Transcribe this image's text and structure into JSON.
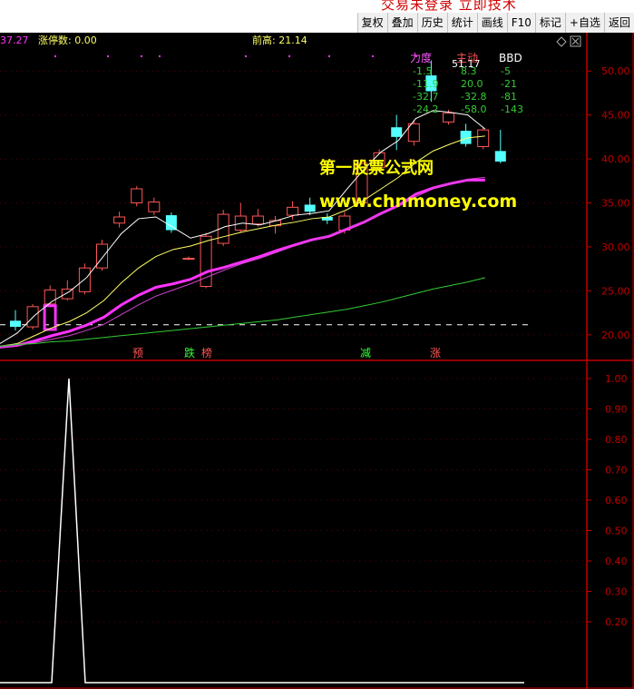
{
  "top_notice": "交易未登录   立即技术",
  "toolbar": [
    "复权",
    "叠加",
    "历史",
    "统计",
    "画线",
    "F10",
    "标记",
    "+自选",
    "返回"
  ],
  "info_bar": {
    "left_value": "37.27",
    "limit_up_count": "涨停数: 0.00",
    "prev_high": "前高: 21.14"
  },
  "right_icons": [
    "diamond-icon",
    "close-icon"
  ],
  "indicator_table": {
    "headers": [
      "力度",
      "主动",
      "BBD"
    ],
    "rows": [
      [
        "-1.5",
        "8.3",
        "-5"
      ],
      [
        "-11.9",
        "20.0",
        "-21"
      ],
      [
        "-32.7",
        "-32.8",
        "-81"
      ],
      [
        "-24.2",
        "-58.0",
        "-143"
      ]
    ],
    "overlay_price": "51.17"
  },
  "watermark": {
    "line1": "第一股票公式网",
    "line2": "www.chnmoney.com"
  },
  "signals": [
    "预",
    "跌",
    "榜",
    "减",
    "涨"
  ],
  "colors": {
    "up": "#ff5555",
    "down": "#54ffff",
    "axis": "#c00000",
    "ma_white": "#ffffff",
    "ma_yellow": "#ffff66",
    "ma_magenta": "#ff33ff",
    "ma_green": "#33cc33",
    "watermark": "#ffff00"
  },
  "chart_data": [
    {
      "type": "candlestick",
      "ylim": [
        17.5,
        52.5
      ],
      "y_ticks": [
        "50.00",
        "45.00",
        "40.00",
        "35.00",
        "30.00",
        "25.00",
        "20.00"
      ],
      "prev_high_line": 21.14,
      "candles": [
        {
          "o": 21.6,
          "c": 20.9,
          "h": 22.8,
          "l": 20.5
        },
        {
          "o": 20.9,
          "c": 23.2,
          "h": 23.5,
          "l": 20.6
        },
        {
          "o": 23.5,
          "c": 25.1,
          "h": 25.6,
          "l": 23.2
        },
        {
          "o": 24.1,
          "c": 25.2,
          "h": 26.2,
          "l": 23.9
        },
        {
          "o": 24.9,
          "c": 27.6,
          "h": 28.1,
          "l": 24.6
        },
        {
          "o": 27.6,
          "c": 30.3,
          "h": 30.8,
          "l": 27.3
        },
        {
          "o": 32.7,
          "c": 33.4,
          "h": 34.0,
          "l": 32.2
        },
        {
          "o": 35.0,
          "c": 36.6,
          "h": 36.9,
          "l": 34.6
        },
        {
          "o": 34.0,
          "c": 35.1,
          "h": 35.6,
          "l": 33.6
        },
        {
          "o": 33.6,
          "c": 31.9,
          "h": 33.9,
          "l": 31.6
        },
        {
          "o": 28.7,
          "c": 28.7,
          "h": 28.9,
          "l": 28.5
        },
        {
          "o": 25.5,
          "c": 31.2,
          "h": 31.6,
          "l": 25.3
        },
        {
          "o": 30.4,
          "c": 33.7,
          "h": 34.2,
          "l": 30.1
        },
        {
          "o": 31.9,
          "c": 33.5,
          "h": 35.0,
          "l": 31.6
        },
        {
          "o": 32.6,
          "c": 33.5,
          "h": 34.3,
          "l": 32.3
        },
        {
          "o": 32.4,
          "c": 33.0,
          "h": 33.5,
          "l": 31.5
        },
        {
          "o": 33.6,
          "c": 34.5,
          "h": 35.2,
          "l": 33.1
        },
        {
          "o": 34.8,
          "c": 34.0,
          "h": 35.6,
          "l": 33.6
        },
        {
          "o": 33.4,
          "c": 33.0,
          "h": 33.8,
          "l": 32.6
        },
        {
          "o": 31.9,
          "c": 33.5,
          "h": 34.0,
          "l": 31.5
        },
        {
          "o": 35.0,
          "c": 39.5,
          "h": 40.0,
          "l": 34.7
        },
        {
          "o": 39.0,
          "c": 40.7,
          "h": 41.1,
          "l": 38.8
        },
        {
          "o": 43.6,
          "c": 42.5,
          "h": 45.0,
          "l": 41.0
        },
        {
          "o": 42.0,
          "c": 44.0,
          "h": 44.4,
          "l": 41.5
        },
        {
          "o": 49.5,
          "c": 47.7,
          "h": 51.2,
          "l": 46.5
        },
        {
          "o": 44.2,
          "c": 45.2,
          "h": 45.6,
          "l": 43.9
        },
        {
          "o": 43.2,
          "c": 41.7,
          "h": 44.0,
          "l": 41.4
        },
        {
          "o": 41.4,
          "c": 43.3,
          "h": 43.6,
          "l": 41.1
        },
        {
          "o": 40.9,
          "c": 39.7,
          "h": 43.3,
          "l": 39.5
        }
      ],
      "series": [
        {
          "values": [
            19.0,
            20.2,
            22.2,
            23.8,
            24.9,
            26.5,
            29.0,
            31.5,
            33.2,
            33.4,
            32.2,
            31.0,
            31.5,
            32.3,
            32.7,
            32.5,
            33.0,
            33.6,
            33.8,
            34.1,
            36.5,
            38.8,
            40.8,
            42.1,
            44.6,
            45.5,
            45.3,
            45.0,
            43.4
          ]
        },
        {
          "values": [
            18.7,
            19.0,
            19.9,
            20.8,
            21.5,
            22.5,
            23.9,
            25.9,
            27.6,
            28.9,
            29.7,
            30.1,
            30.7,
            31.2,
            31.7,
            32.1,
            32.5,
            32.8,
            33.2,
            33.4,
            34.2,
            35.3,
            36.6,
            37.9,
            39.6,
            40.9,
            41.7,
            42.4,
            42.6
          ]
        },
        {
          "values": [
            18.6,
            18.8,
            19.3,
            19.9,
            20.4,
            21.1,
            22.0,
            23.4,
            24.5,
            25.4,
            25.8,
            26.3,
            27.2,
            27.7,
            28.3,
            28.9,
            29.6,
            30.2,
            30.8,
            31.2,
            32.0,
            32.8,
            33.8,
            34.7,
            36.0,
            36.7,
            37.2,
            37.6,
            37.6
          ]
        },
        {
          "values": [
            18.6,
            18.8,
            19.1,
            19.5,
            19.9,
            20.5,
            21.2,
            22.3,
            23.4,
            24.4,
            25.1,
            25.8,
            26.6,
            27.4,
            28.1,
            28.7,
            29.4,
            30.1,
            30.7,
            31.3,
            32.1,
            32.9,
            33.7,
            34.6,
            35.7,
            36.6,
            37.2,
            37.7,
            37.9
          ]
        },
        {
          "values": [
            18.7,
            18.9,
            19.0,
            19.2,
            19.3,
            19.5,
            19.7,
            19.9,
            20.1,
            20.3,
            20.5,
            20.7,
            20.9,
            21.1,
            21.3,
            21.5,
            21.7,
            22.0,
            22.3,
            22.6,
            22.9,
            23.3,
            23.7,
            24.2,
            24.7,
            25.2,
            25.6,
            26.0,
            26.5
          ]
        }
      ]
    },
    {
      "type": "line",
      "ylim": [
        0,
        1.0
      ],
      "y_ticks": [
        "1.00",
        "0.90",
        "0.80",
        "0.70",
        "0.60",
        "0.50",
        "0.40",
        "0.30",
        "0.20"
      ],
      "values": [
        0,
        0,
        0,
        0,
        1,
        0,
        0,
        0,
        0,
        0,
        0,
        0,
        0,
        0,
        0,
        0,
        0,
        0,
        0,
        0,
        0,
        0,
        0,
        0,
        0,
        0,
        0,
        0,
        0,
        0,
        0,
        0,
        0,
        0
      ]
    }
  ]
}
